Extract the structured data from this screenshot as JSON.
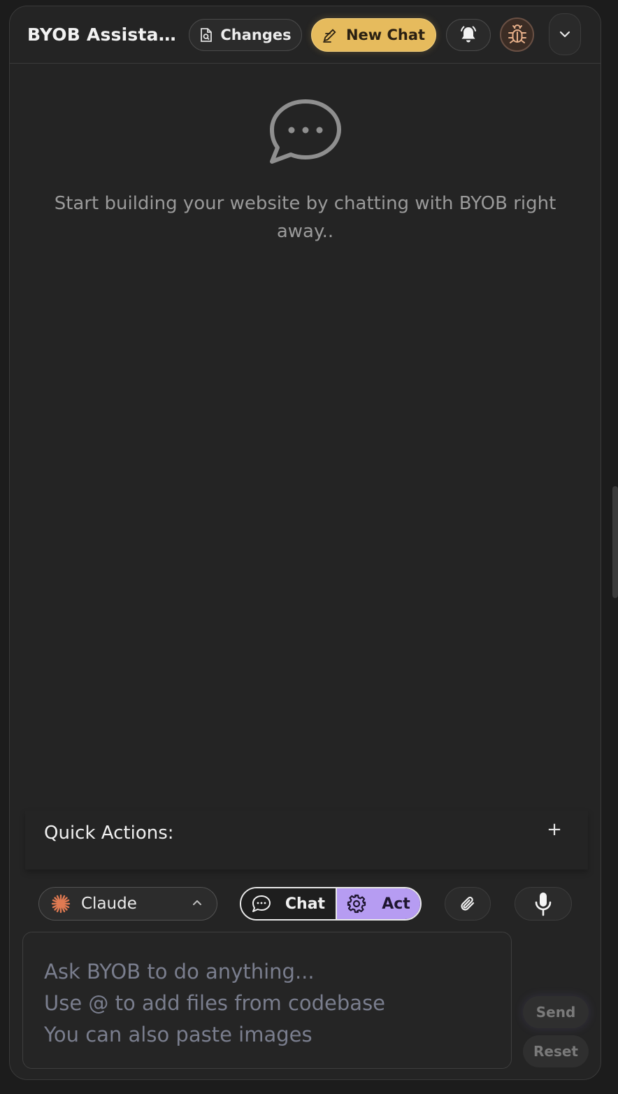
{
  "header": {
    "title": "BYOB Assista...",
    "changes_label": "Changes",
    "new_chat_label": "New Chat"
  },
  "empty_state": {
    "message": "Start building your website by chatting with BYOB right away.."
  },
  "quick_actions": {
    "label": "Quick Actions:",
    "add_symbol": "+"
  },
  "toolbar": {
    "model_name": "Claude",
    "mode_chat_label": "Chat",
    "mode_act_label": "Act",
    "active_mode": "Act"
  },
  "input": {
    "placeholder": "Ask BYOB to do anything...\nUse @ to add files from codebase\nYou can also paste images"
  },
  "actions": {
    "send_label": "Send",
    "reset_label": "Reset"
  },
  "colors": {
    "accent_gold": "#e6bb5d",
    "accent_purple": "#b69cf2",
    "claude_orange": "#e07a52",
    "avatar_bug": "#e8b08a"
  },
  "icons": [
    "file-search-icon",
    "pencil-icon",
    "bell-icon",
    "bug-icon",
    "chevron-down-icon",
    "chat-bubble-icon",
    "claude-spark-icon",
    "chevron-up-icon",
    "gear-icon",
    "paperclip-icon",
    "microphone-icon"
  ]
}
